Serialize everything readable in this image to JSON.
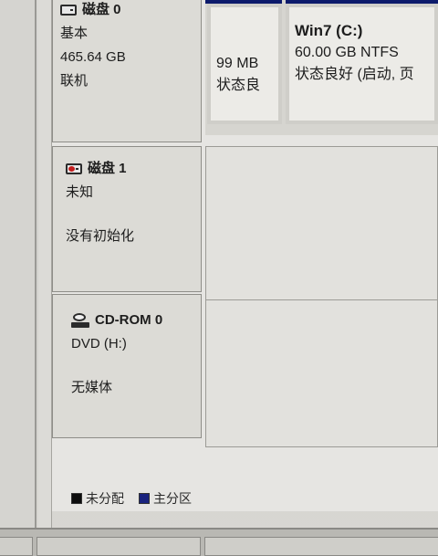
{
  "disks": [
    {
      "title": "磁盘 0",
      "icon": "disk-icon",
      "type": "基本",
      "size": "465.64 GB",
      "status": "联机",
      "partitions": [
        {
          "size": "99 MB",
          "status": "状态良"
        },
        {
          "name": "Win7  (C:)",
          "size": "60.00 GB NTFS",
          "status": "状态良好 (启动, 页"
        }
      ]
    },
    {
      "title": "磁盘 1",
      "icon": "disk-error-icon",
      "type": "未知",
      "status": "没有初始化"
    },
    {
      "title": "CD-ROM 0",
      "icon": "cdrom-icon",
      "type": "DVD (H:)",
      "status": "无媒体"
    }
  ],
  "legend": [
    {
      "label": "未分配",
      "color": "#0d0d0d"
    },
    {
      "label": "主分区",
      "color": "#1a237e"
    }
  ],
  "colors": {
    "partition_bar": "#0c1a6b"
  }
}
